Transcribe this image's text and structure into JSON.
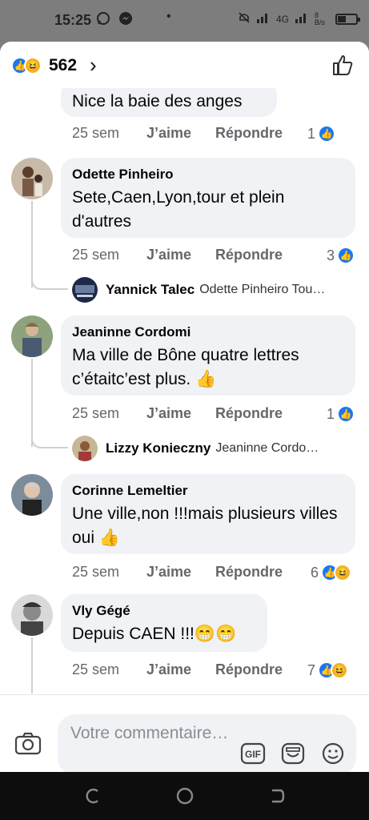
{
  "status_bar": {
    "time": "15:25",
    "network": "4G",
    "speed": "8 B/s"
  },
  "reactions": {
    "count": "562",
    "types": [
      "like-icon",
      "haha-icon"
    ]
  },
  "comments": [
    {
      "author": "",
      "text": "Nice la baie des anges",
      "time": "25 sem",
      "like": "J’aime",
      "reply": "Répondre",
      "reaction_count": "1",
      "reactions": [
        "like-icon"
      ]
    },
    {
      "author": "Odette Pinheiro",
      "text": "Sete,Caen,Lyon,tour et plein d'autres",
      "time": "25 sem",
      "like": "J’aime",
      "reply": "Répondre",
      "reaction_count": "3",
      "reactions": [
        "like-icon"
      ],
      "reply_preview": {
        "author": "Yannick Talec",
        "text": "Odette Pinheiro Tou…"
      }
    },
    {
      "author": "Jeaninne Cordomi",
      "text": "Ma ville de Bône quatre lettres c’étaitc’est plus. 👍",
      "time": "25 sem",
      "like": "J’aime",
      "reply": "Répondre",
      "reaction_count": "1",
      "reactions": [
        "like-icon"
      ],
      "reply_preview": {
        "author": "Lizzy Konieczny",
        "text": "Jeaninne Cordo…"
      }
    },
    {
      "author": "Corinne Lemeltier",
      "text": "Une ville,non !!!mais plusieurs villes oui 👍",
      "time": "25 sem",
      "like": "J’aime",
      "reply": "Répondre",
      "reaction_count": "6",
      "reactions": [
        "like-icon",
        "haha-icon"
      ]
    },
    {
      "author": "Vly Gégé",
      "text": "Depuis CAEN !!!😁😁",
      "time": "25 sem",
      "like": "J’aime",
      "reply": "Répondre",
      "reaction_count": "7",
      "reactions": [
        "like-icon",
        "haha-icon"
      ]
    }
  ],
  "composer": {
    "placeholder": "Votre commentaire…",
    "gif_label": "GIF"
  },
  "colors": {
    "accent": "#1877f2",
    "bubble": "#f0f2f5",
    "meta": "#65676b",
    "haha": "#f7b125"
  }
}
